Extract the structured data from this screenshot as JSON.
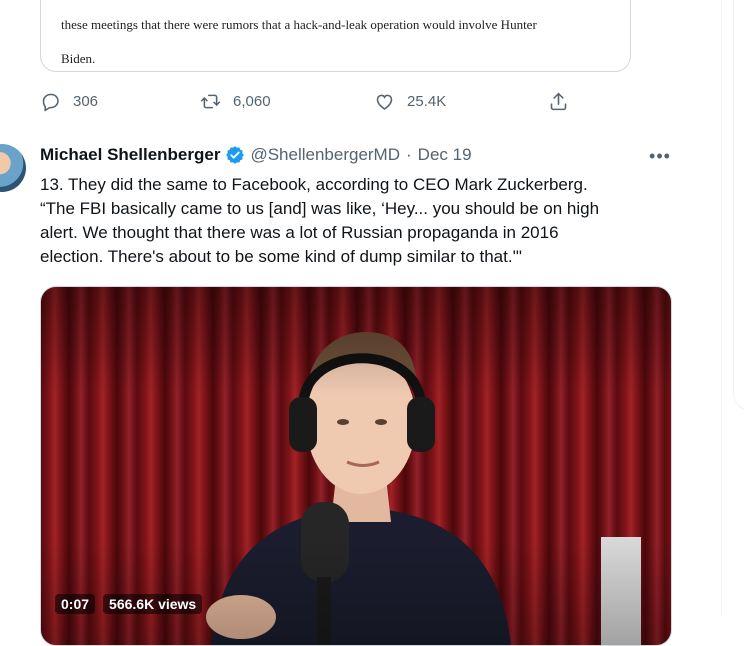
{
  "quoted_document": {
    "line1": "these meetings that there were rumors that a hack-and-leak operation would involve Hunter",
    "line2": "Biden."
  },
  "previous_tweet_actions": {
    "replies": "306",
    "retweets": "6,060",
    "likes": "25.4K"
  },
  "tweet": {
    "author_name": "Michael Shellenberger",
    "handle": "@ShellenbergerMD",
    "separator": "·",
    "date": "Dec 19",
    "more": "•••",
    "text": "13. They did the same to Facebook, according to CEO Mark Zuckerberg.\n“The FBI basically came to us [and] was like, ‘Hey... you should be on high\nalert. We thought that there was a lot of Russian propaganda in 2016\nelection. There's about to be some kind of dump similar to that.'\"",
    "video": {
      "time": "0:07",
      "views": "566.6K views"
    }
  },
  "colors": {
    "verified_blue": "#1d9bf0",
    "secondary_text": "#536471",
    "border": "#cfd9de"
  }
}
